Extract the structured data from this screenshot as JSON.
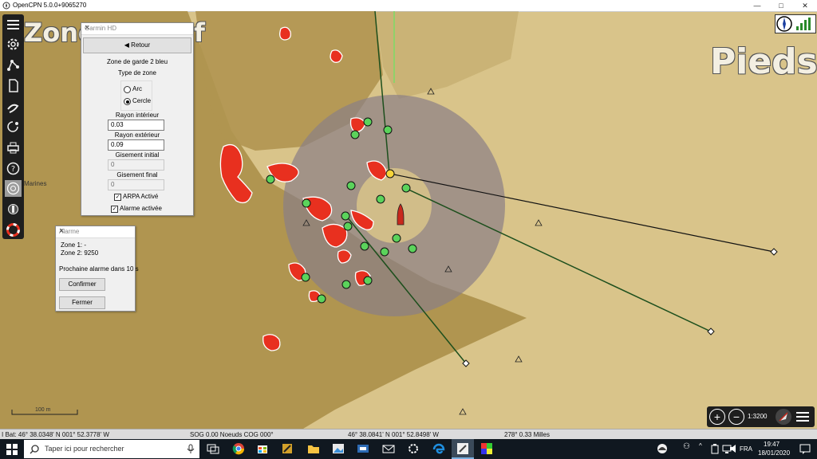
{
  "window": {
    "title": "OpenCPN 5.0.0+9065270",
    "controls": [
      "—",
      "□",
      "✕"
    ]
  },
  "chart": {
    "overlay_left": "Zone",
    "overlay_left_tail": "f",
    "overlay_right": "Pieds",
    "place_label": "Marines",
    "scale_bar": "100 m"
  },
  "radar_panel": {
    "title": "Garmin HD",
    "back_button": "◀ Retour",
    "heading": "Zone de garde 2 bleu",
    "zone_type_label": "Type de zone",
    "options": [
      "Arc",
      "Cercle"
    ],
    "selected_option": "Cercle",
    "inner_radius_label": "Rayon intérieur",
    "inner_radius_value": "0.03",
    "outer_radius_label": "Rayon extérieur",
    "outer_radius_value": "0.09",
    "start_bearing_label": "Gisement initial",
    "start_bearing_value": "0",
    "end_bearing_label": "Gisement final",
    "end_bearing_value": "0",
    "arpa_label": "ARPA Activé",
    "alarm_label": "Alarme activée"
  },
  "alarm_panel": {
    "title": "Alarme",
    "zone1": "Zone 1: -",
    "zone2": "Zone 2: 9250",
    "next_alarm": "Prochaine alarme dans 10 s",
    "confirm_button": "Confirmer",
    "close_button": "Fermer"
  },
  "map_controls": {
    "zoom_in": "+",
    "zoom_out": "−",
    "scale": "1:3200"
  },
  "status": {
    "position": "I Bat: 46° 38.0348' N    001° 52.3778' W",
    "speed": "SOG 0.00 Noeuds  COG 000°",
    "cursor": "46° 38.0841' N    001° 52.8498' W",
    "bearing": "278°  0.33 Milles"
  },
  "taskbar": {
    "search_placeholder": "Taper ici pour rechercher",
    "lang": "FRA",
    "time": "19:47",
    "date": "18/01/2020"
  },
  "colors": {
    "land": "#d9c48a",
    "shoal": "#b09550",
    "echo": "#e8301f",
    "guard_zone": "#8a7f86",
    "target": "#5bd35b",
    "route_line": "#1d4f1d"
  }
}
